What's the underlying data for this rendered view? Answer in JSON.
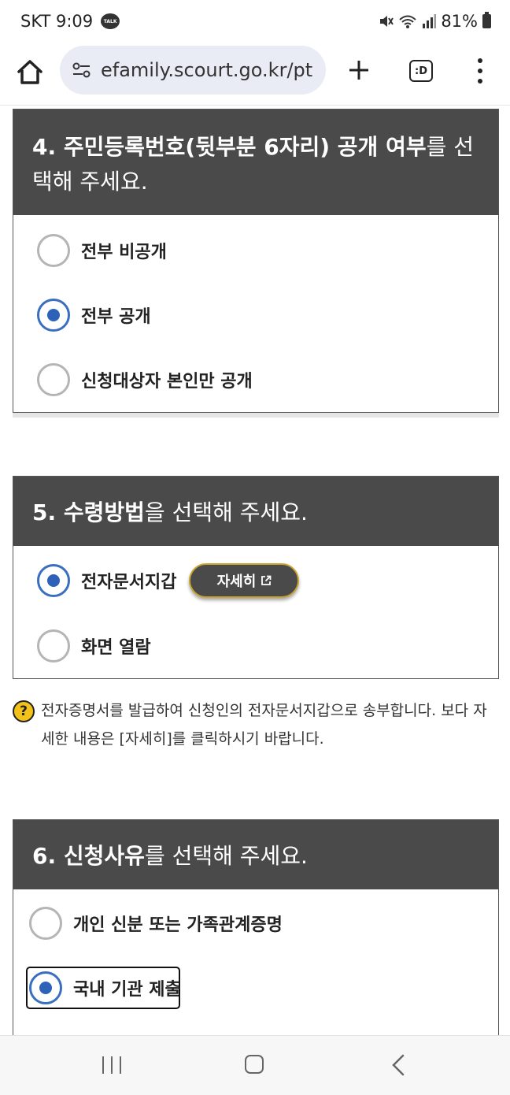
{
  "status_bar": {
    "carrier_time": "SKT 9:09",
    "talk_badge": "TALK",
    "battery": "81%",
    "icons": [
      "mute-icon",
      "wifi-icon",
      "signal-icon",
      "battery-icon"
    ]
  },
  "browser": {
    "url": "efamily.scourt.go.kr/pt",
    "tabs_label": ":D",
    "icons": [
      "home-icon",
      "site-settings-icon",
      "new-tab-icon",
      "tabs-icon",
      "more-menu-icon"
    ]
  },
  "section4": {
    "title_bold": "4. 주민등록번호(뒷부분 6자리) 공개 여부",
    "title_rest": "를 선택해 주세요.",
    "options": [
      {
        "label": "전부 비공개",
        "checked": false
      },
      {
        "label": "전부 공개",
        "checked": true
      },
      {
        "label": "신청대상자 본인만 공개",
        "checked": false
      }
    ]
  },
  "section5": {
    "title_bold": "5. 수령방법",
    "title_rest": "을 선택해 주세요.",
    "options": [
      {
        "label": "전자문서지갑",
        "checked": true
      },
      {
        "label": "화면 열람",
        "checked": false
      }
    ],
    "detail_button": "자세히"
  },
  "help": {
    "icon": "?",
    "text": "전자증명서를 발급하여 신청인의 전자문서지갑으로 송부합니다. 보다 자세한 내용은 [자세히]를 클릭하시기 바랍니다."
  },
  "section6": {
    "title_bold": "6. 신청사유",
    "title_rest": "를 선택해 주세요.",
    "options": [
      {
        "label": "개인 신분 또는 가족관계증명",
        "checked": false
      },
      {
        "label": "국내 기관 제출",
        "checked": true
      }
    ]
  },
  "colors": {
    "header_bg": "#4a4a4a",
    "radio_checked": "#2d62b8",
    "help_yellow": "#f2c21b",
    "button_border": "#c8a431"
  }
}
